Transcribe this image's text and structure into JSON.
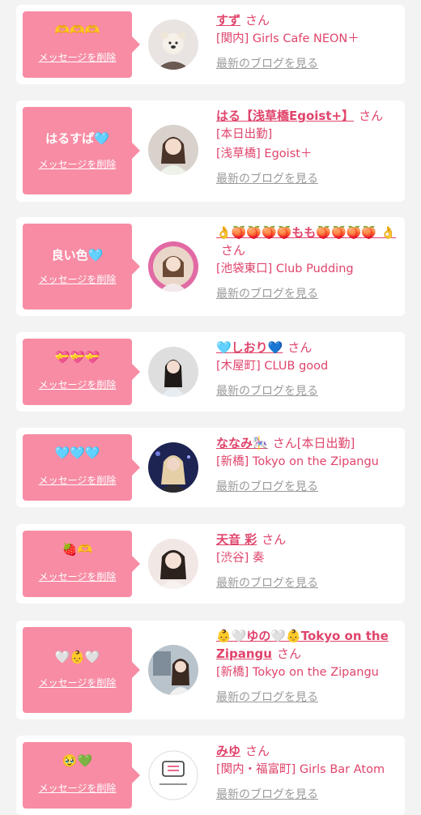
{
  "delete_label": "メッセージを削除",
  "honorific": "さん",
  "blog_label": "最新のブログを見る",
  "colors": {
    "bubble": "#f78ca4",
    "name": "#e0446b",
    "link_gray": "#9a9a9a",
    "bg": "#f3f3f3"
  },
  "cards": [
    {
      "message": "🫶🫶🫶",
      "name": "すず",
      "shop1": "[関内] Girls Cafe NEON＋",
      "shop2": ""
    },
    {
      "message": "はるすぱ🩵",
      "name": "はる【浅草橋Egoist+】",
      "shop1": "[本日出勤]",
      "shop2": "[浅草橋] Egoist＋"
    },
    {
      "message": "良い色🩵",
      "name": "👌🍑🍑🍑🍑もも🍑🍑🍑🍑 👌",
      "shop1": "[池袋東口] Club Pudding",
      "shop2": ""
    },
    {
      "message": "💝💝💝",
      "name": "🩵しおり💙",
      "shop1": "[木屋町] CLUB good",
      "shop2": ""
    },
    {
      "message": "🩵🩵🩵",
      "name": "ななみ🎠",
      "suffix": "[本日出勤]",
      "shop1": "[新橋] Tokyo on the Zipangu",
      "shop2": ""
    },
    {
      "message": "🍓🫶",
      "name": "天音 彩",
      "shop1": "[渋谷] 奏",
      "shop2": ""
    },
    {
      "message": "🤍👶🤍",
      "name": "👶🤍ゆの🤍👶Tokyo on the Zipangu",
      "shop1": "[新橋] Tokyo on the Zipangu",
      "shop2": ""
    },
    {
      "message": "🥹💚",
      "name": "みゆ",
      "shop1": "[関内・福富町] Girls Bar Atom",
      "shop2": ""
    }
  ]
}
